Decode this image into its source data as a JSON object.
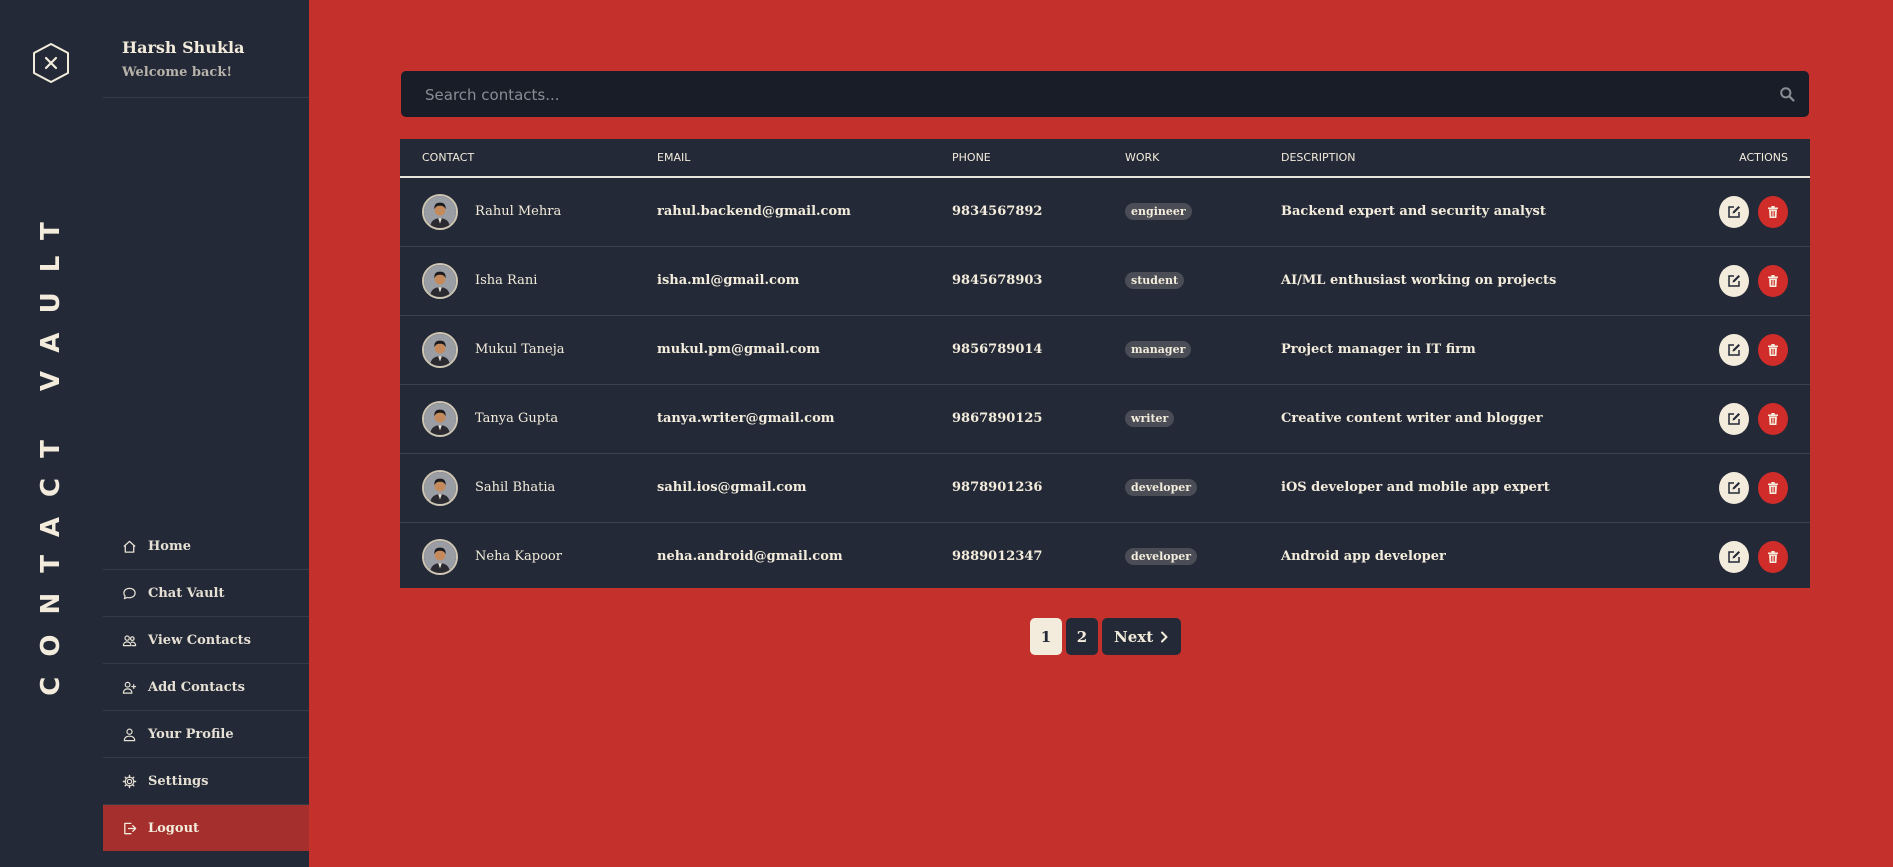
{
  "brand": {
    "title": "CONTACT VAULT"
  },
  "user": {
    "name": "Harsh Shukla",
    "welcome": "Welcome back!"
  },
  "nav": {
    "items": [
      {
        "label": "Home",
        "icon": "home-icon"
      },
      {
        "label": "Chat Vault",
        "icon": "chat-icon"
      },
      {
        "label": "View Contacts",
        "icon": "users-icon"
      },
      {
        "label": "Add Contacts",
        "icon": "user-plus-icon"
      },
      {
        "label": "Your Profile",
        "icon": "user-icon"
      },
      {
        "label": "Settings",
        "icon": "gear-icon"
      },
      {
        "label": "Logout",
        "icon": "logout-icon"
      }
    ]
  },
  "search": {
    "placeholder": "Search contacts...",
    "value": ""
  },
  "table": {
    "headers": {
      "contact": "CONTACT",
      "email": "EMAIL",
      "phone": "PHONE",
      "work": "WORK",
      "description": "DESCRIPTION",
      "actions": "ACTIONS"
    },
    "rows": [
      {
        "name": "Rahul Mehra",
        "email": "rahul.backend@gmail.com",
        "phone": "9834567892",
        "work": "engineer",
        "description": "Backend expert and security analyst"
      },
      {
        "name": "Isha Rani",
        "email": "isha.ml@gmail.com",
        "phone": "9845678903",
        "work": "student",
        "description": "AI/ML enthusiast working on projects"
      },
      {
        "name": "Mukul Taneja",
        "email": "mukul.pm@gmail.com",
        "phone": "9856789014",
        "work": "manager",
        "description": "Project manager in IT firm"
      },
      {
        "name": "Tanya Gupta",
        "email": "tanya.writer@gmail.com",
        "phone": "9867890125",
        "work": "writer",
        "description": "Creative content writer and blogger"
      },
      {
        "name": "Sahil Bhatia",
        "email": "sahil.ios@gmail.com",
        "phone": "9878901236",
        "work": "developer",
        "description": "iOS developer and mobile app expert"
      },
      {
        "name": "Neha Kapoor",
        "email": "neha.android@gmail.com",
        "phone": "9889012347",
        "work": "developer",
        "description": "Android app developer"
      }
    ]
  },
  "pagination": {
    "pages": [
      "1",
      "2"
    ],
    "current": "1",
    "next_label": "Next"
  },
  "colors": {
    "background": "#c4302b",
    "panel": "#232936",
    "accent_cream": "#f3ecdc",
    "danger": "#d02c2a",
    "logout": "#a52f2d"
  }
}
